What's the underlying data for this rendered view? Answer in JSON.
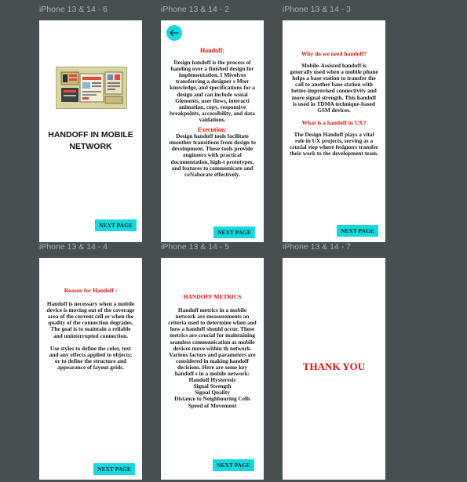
{
  "frames": [
    {
      "label": "iPhone 13 & 14 - 6",
      "title": "HANDOFF IN MOBILE NETWORK",
      "button": "NEXT PAGE"
    },
    {
      "label": "iPhone 13 & 14 - 2",
      "heading1": "Handoff:",
      "text1": "Design handoff is the process of handing over a finished design for implementation. I Mivolves transferring a designer s Mter knowledge, and specifications for a design and can include wsual Glements, user flows, interacti animation, copy, responsive breakpoints, accessibility, and data vaidations.",
      "heading2": "Execution:",
      "text2": "Design handoff tools facilitate smoother transitions from design to development. These tools provide engineers with practical documentation, high-t prototypes, and features to communicate and coNaborate effectively.",
      "button": "NEXT PAGE",
      "back_icon": "arrow-left-icon"
    },
    {
      "label": "iPhone 13 & 14 - 3",
      "heading1": "Why do we need handoff?",
      "text1": "Mobile-Assisted handoff is generally used when a mobile phone helps a base station to transfer the call to another base station with better-improvised connectivity and more signal strength. This handoff is used in TDMA technique-based GSM devices.",
      "heading2": "What is a handoff in UX?",
      "text2": "The Design Handoff plays a vital role in UX projects, serving as a crucial step where fesigners transfer their work to the development team.",
      "button": "NEXT PAGE"
    },
    {
      "label": "iPhone 13 & 14 - 4",
      "heading1": "Reason for Handoff :",
      "text1": "Handoff is necessary when a mobile device is moving out of the coverage area of the current cell or when the quality of the connection degrades. The goal is to maintain a reliable and uninterrupted connection.",
      "text2": "Use styles to define the color, text and any effects applied to objects; or to define the structure and appearance of layout grids.",
      "button": "NEXT PAGE"
    },
    {
      "label": "iPhone 13 & 14 - 5",
      "heading1": "HANDOFF METRICS",
      "text1": "Handoff metrics in a mobile network are measurements an criteria used to determine when and how a handoff should occur. These metrics are crucial for maintaining seamless communication as mobile devices move within th network. Various factors and parameters are considered in making handoff decisions. Here are some key handoff s in a mobile network:",
      "list": [
        "Handoff Hysteresis",
        "Signal Strength",
        "Signal Quality",
        "Distance to Neighbouring Cells",
        "Speed of Movement"
      ],
      "button": "NEXT PAGE"
    },
    {
      "label": "iPhone 13 & 14 - 7",
      "title": "THANK YOU"
    }
  ],
  "colors": {
    "canvas": "#465050",
    "frame": "#ffffff",
    "accent": "#16d9df",
    "heading": "#e01010"
  }
}
